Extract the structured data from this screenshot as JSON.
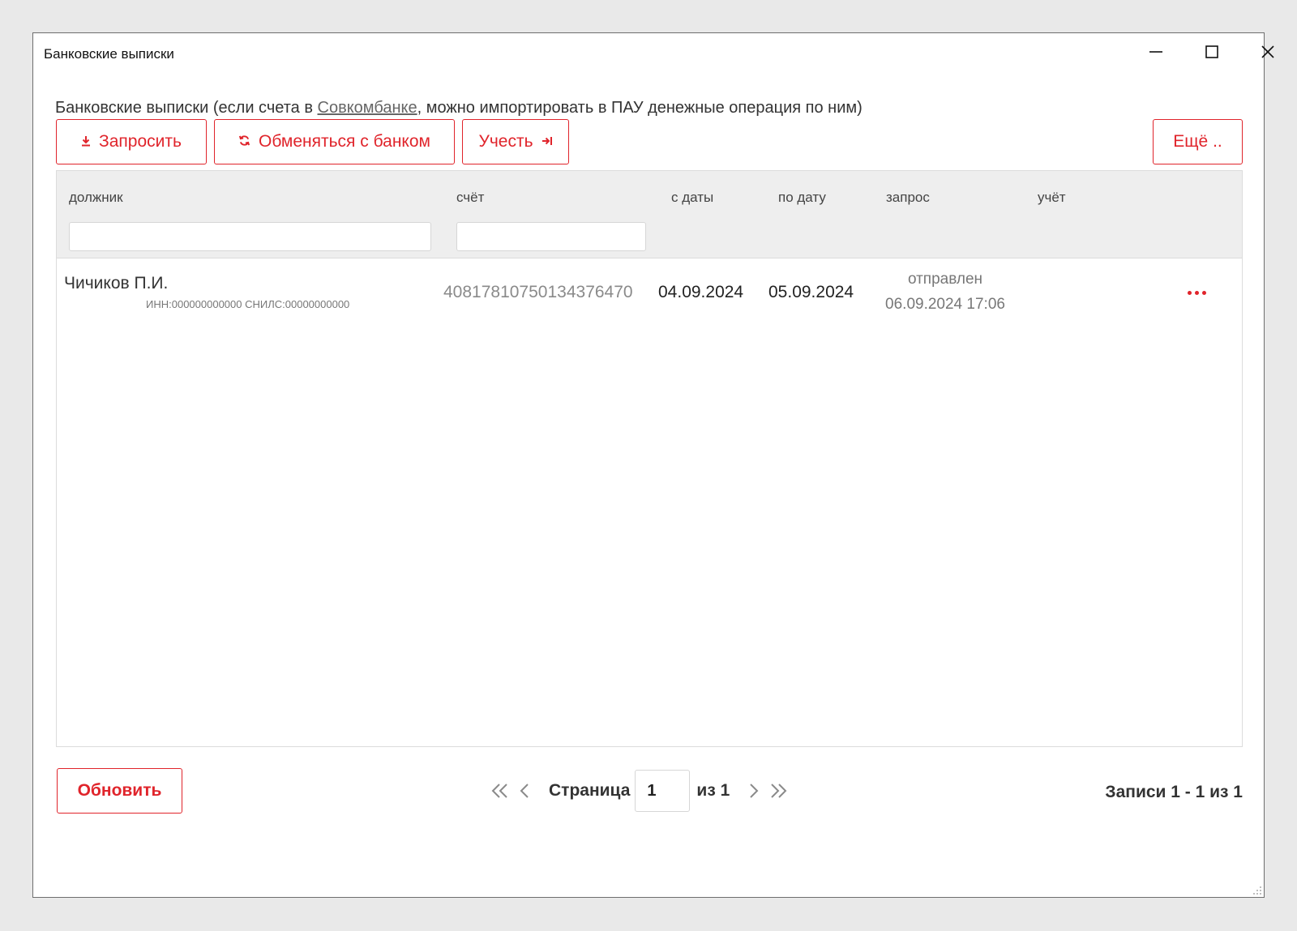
{
  "window": {
    "title": "Банковские выписки"
  },
  "description": {
    "prefix": "Банковские выписки (если счета в ",
    "link": "Совкомбанке",
    "suffix": ", можно импортировать в ПАУ денежные операция по ним)"
  },
  "toolbar": {
    "request_label": "Запросить",
    "exchange_label": "Обменяться с банком",
    "account_label": "Учесть",
    "more_label": "Ещё .."
  },
  "grid": {
    "columns": {
      "debtor": "должник",
      "account": "счёт",
      "date_from": "с даты",
      "date_to": "по дату",
      "request": "запрос",
      "accounting": "учёт"
    },
    "filters": {
      "debtor_value": "",
      "account_value": ""
    },
    "rows": [
      {
        "debtor_name": "Чичиков П.И.",
        "debtor_ids": "ИНН:000000000000 СНИЛС:00000000000",
        "account": "40817810750134376470",
        "date_from": "04.09.2024",
        "date_to": "05.09.2024",
        "request_status": "отправлен",
        "request_time": "06.09.2024 17:06",
        "accounting": ""
      }
    ]
  },
  "footer": {
    "refresh_label": "Обновить",
    "page_label": "Страница",
    "page_value": "1",
    "page_of": "из 1",
    "records": "Записи 1 - 1 из 1"
  },
  "colors": {
    "accent": "#e0242b",
    "header_bg": "#eeeeee"
  },
  "icons": {
    "request": "download-icon",
    "exchange": "sync-icon",
    "account": "arrow-right-bar-icon"
  }
}
